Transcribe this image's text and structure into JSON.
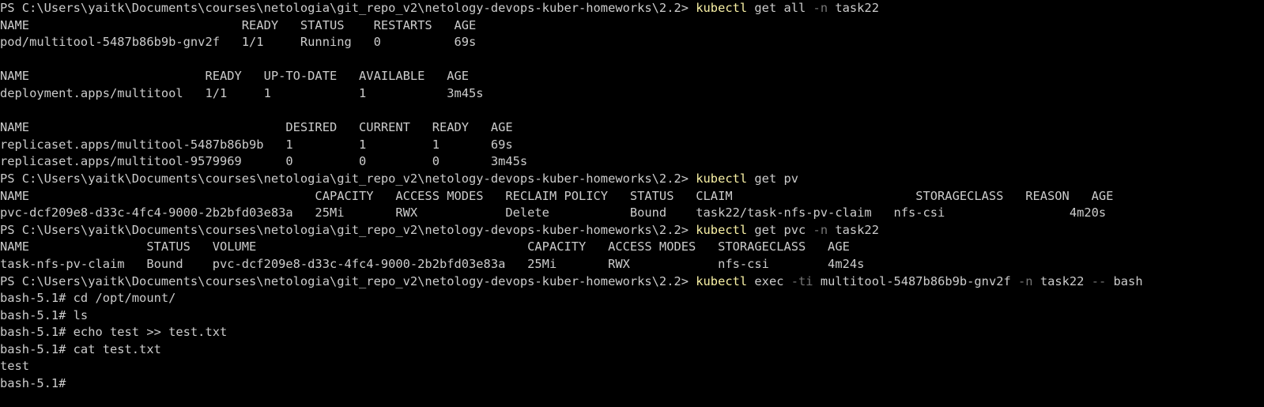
{
  "colors": {
    "background": "#000000",
    "foreground": "#cccccc",
    "command": "#f9f1a5",
    "flag": "#767676"
  },
  "terminal": {
    "lines": [
      {
        "type": "cmd",
        "prompt": "PS C:\\Users\\yaitk\\Documents\\courses\\netologia\\git_repo_v2\\netology-devops-kuber-homeworks\\2.2> ",
        "parts": [
          {
            "k": "name",
            "t": "kubectl"
          },
          {
            "k": "arg",
            "t": " get all "
          },
          {
            "k": "flag",
            "t": "-n"
          },
          {
            "k": "arg",
            "t": " task22"
          }
        ]
      },
      {
        "type": "out",
        "text": "NAME                             READY   STATUS    RESTARTS   AGE"
      },
      {
        "type": "out",
        "text": "pod/multitool-5487b86b9b-gnv2f   1/1     Running   0          69s"
      },
      {
        "type": "out",
        "text": ""
      },
      {
        "type": "out",
        "text": "NAME                        READY   UP-TO-DATE   AVAILABLE   AGE"
      },
      {
        "type": "out",
        "text": "deployment.apps/multitool   1/1     1            1           3m45s"
      },
      {
        "type": "out",
        "text": ""
      },
      {
        "type": "out",
        "text": "NAME                                   DESIRED   CURRENT   READY   AGE"
      },
      {
        "type": "out",
        "text": "replicaset.apps/multitool-5487b86b9b   1         1         1       69s"
      },
      {
        "type": "out",
        "text": "replicaset.apps/multitool-9579969      0         0         0       3m45s"
      },
      {
        "type": "cmd",
        "prompt": "PS C:\\Users\\yaitk\\Documents\\courses\\netologia\\git_repo_v2\\netology-devops-kuber-homeworks\\2.2> ",
        "parts": [
          {
            "k": "name",
            "t": "kubectl"
          },
          {
            "k": "arg",
            "t": " get pv"
          }
        ]
      },
      {
        "type": "out",
        "text": "NAME                                       CAPACITY   ACCESS MODES   RECLAIM POLICY   STATUS   CLAIM                         STORAGECLASS   REASON   AGE"
      },
      {
        "type": "out",
        "text": "pvc-dcf209e8-d33c-4fc4-9000-2b2bfd03e83a   25Mi       RWX            Delete           Bound    task22/task-nfs-pv-claim   nfs-csi                 4m20s"
      },
      {
        "type": "cmd",
        "prompt": "PS C:\\Users\\yaitk\\Documents\\courses\\netologia\\git_repo_v2\\netology-devops-kuber-homeworks\\2.2> ",
        "parts": [
          {
            "k": "name",
            "t": "kubectl"
          },
          {
            "k": "arg",
            "t": " get pvc "
          },
          {
            "k": "flag",
            "t": "-n"
          },
          {
            "k": "arg",
            "t": " task22"
          }
        ]
      },
      {
        "type": "out",
        "text": "NAME                STATUS   VOLUME                                     CAPACITY   ACCESS MODES   STORAGECLASS   AGE"
      },
      {
        "type": "out",
        "text": "task-nfs-pv-claim   Bound    pvc-dcf209e8-d33c-4fc4-9000-2b2bfd03e83a   25Mi       RWX            nfs-csi        4m24s"
      },
      {
        "type": "cmd",
        "prompt": "PS C:\\Users\\yaitk\\Documents\\courses\\netologia\\git_repo_v2\\netology-devops-kuber-homeworks\\2.2> ",
        "parts": [
          {
            "k": "name",
            "t": "kubectl"
          },
          {
            "k": "arg",
            "t": " exec "
          },
          {
            "k": "flag",
            "t": "-ti"
          },
          {
            "k": "arg",
            "t": " multitool-5487b86b9b-gnv2f "
          },
          {
            "k": "flag",
            "t": "-n"
          },
          {
            "k": "arg",
            "t": " task22 "
          },
          {
            "k": "flag",
            "t": "--"
          },
          {
            "k": "arg",
            "t": " bash"
          }
        ]
      },
      {
        "type": "out",
        "text": "bash-5.1# cd /opt/mount/"
      },
      {
        "type": "out",
        "text": "bash-5.1# ls"
      },
      {
        "type": "out",
        "text": "bash-5.1# echo test >> test.txt"
      },
      {
        "type": "out",
        "text": "bash-5.1# cat test.txt"
      },
      {
        "type": "out",
        "text": "test"
      },
      {
        "type": "out",
        "text": "bash-5.1# "
      }
    ]
  }
}
